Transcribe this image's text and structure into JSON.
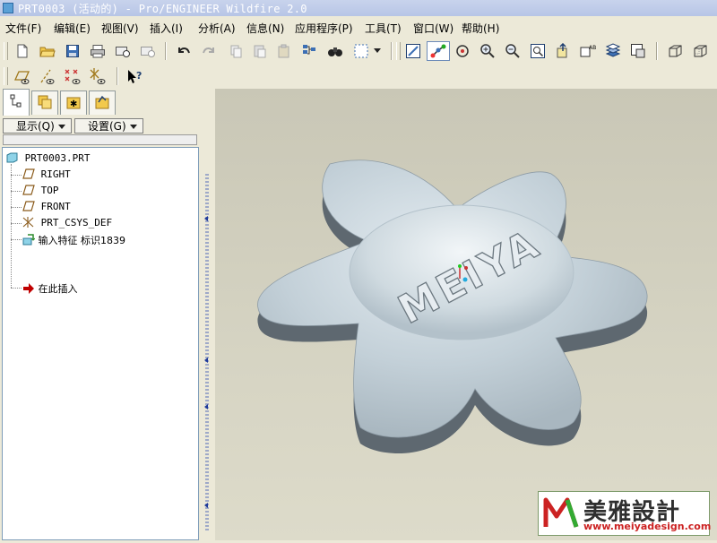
{
  "window": {
    "title": "PRT0003 (活动的) - Pro/ENGINEER Wildfire 2.0"
  },
  "menu": [
    {
      "label": "文件(F)"
    },
    {
      "label": "编辑(E)"
    },
    {
      "label": "视图(V)"
    },
    {
      "label": "插入(I)"
    },
    {
      "label": "分析(A)"
    },
    {
      "label": "信息(N)"
    },
    {
      "label": "应用程序(P)"
    },
    {
      "label": "工具(T)"
    },
    {
      "label": "窗口(W)"
    },
    {
      "label": "帮助(H)"
    }
  ],
  "panel": {
    "show_label": "显示(Q)",
    "settings_label": "设置(G)",
    "tree": [
      {
        "label": "PRT0003.PRT",
        "icon": "part-icon"
      },
      {
        "label": "RIGHT",
        "icon": "datum-plane-icon"
      },
      {
        "label": "TOP",
        "icon": "datum-plane-icon"
      },
      {
        "label": "FRONT",
        "icon": "datum-plane-icon"
      },
      {
        "label": "PRT_CSYS_DEF",
        "icon": "csys-icon"
      },
      {
        "label": "输入特征 标识1839",
        "icon": "import-feature-icon"
      },
      {
        "label": "在此插入",
        "icon": "insert-here-arrow-icon"
      }
    ]
  },
  "model": {
    "embossed_text": "MEIYA"
  },
  "watermark": {
    "brand": "美雅設計",
    "url": "www.meiyadesign.com"
  },
  "colors": {
    "title_text": "#ffffff",
    "model": "#b9c6cf",
    "insert_arrow": "#c00000"
  }
}
